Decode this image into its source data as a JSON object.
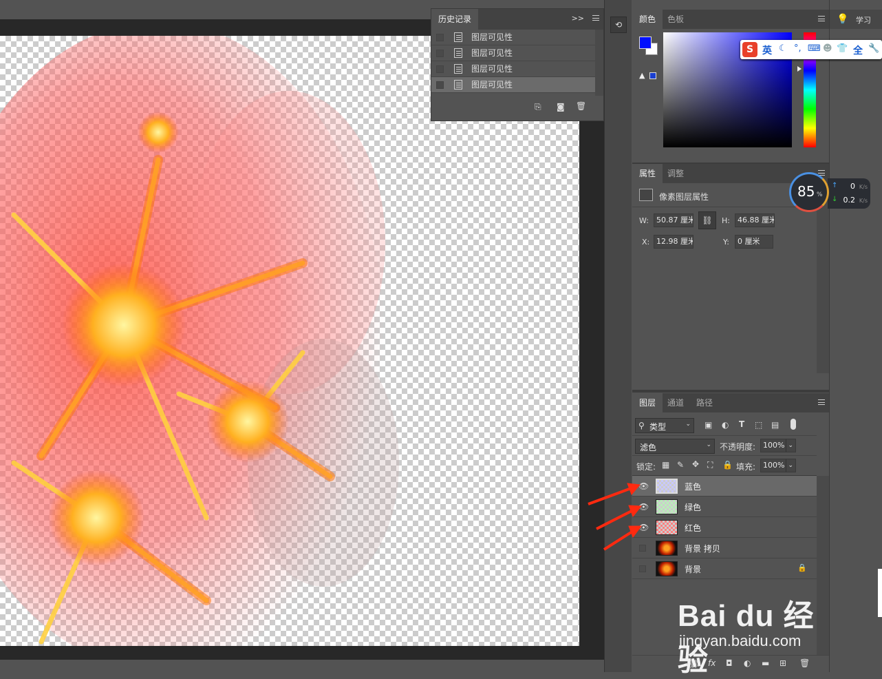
{
  "history": {
    "title": "历史记录",
    "items": [
      "图层可见性",
      "图层可见性",
      "图层可见性",
      "图层可见性"
    ]
  },
  "color_panel": {
    "tabs": [
      "颜色",
      "色板"
    ],
    "fg_color": "#0010ff",
    "bg_color": "#ffffff"
  },
  "ime_bar": {
    "logo": "S",
    "items": [
      "英",
      "全"
    ]
  },
  "properties": {
    "tabs": [
      "属性",
      "调整"
    ],
    "header": "像素图层属性",
    "w_label": "W:",
    "w_value": "50.87 厘米",
    "h_label": "H:",
    "h_value": "46.88 厘米",
    "x_label": "X:",
    "x_value": "12.98 厘米",
    "y_label": "Y:",
    "y_value": "0 厘米"
  },
  "net_monitor": {
    "percent": "85",
    "percent_unit": "%",
    "up": "0",
    "up_unit": "K/s",
    "down": "0.2",
    "down_unit": "K/s"
  },
  "layers_panel": {
    "tabs": [
      "图层",
      "通道",
      "路径"
    ],
    "filter_label": "类型",
    "blend_mode": "滤色",
    "opacity_label": "不透明度:",
    "opacity_value": "100%",
    "lock_label": "锁定:",
    "fill_label": "填充:",
    "fill_value": "100%",
    "layers": [
      {
        "name": "蓝色",
        "visible": true
      },
      {
        "name": "绿色",
        "visible": true
      },
      {
        "name": "红色",
        "visible": true
      },
      {
        "name": "背景 拷贝",
        "visible": false
      },
      {
        "name": "背景",
        "visible": false
      }
    ]
  },
  "learn": {
    "label": "学习"
  },
  "watermark": {
    "brand": "Bai du 经验",
    "url": "jingyan.baidu.com"
  }
}
